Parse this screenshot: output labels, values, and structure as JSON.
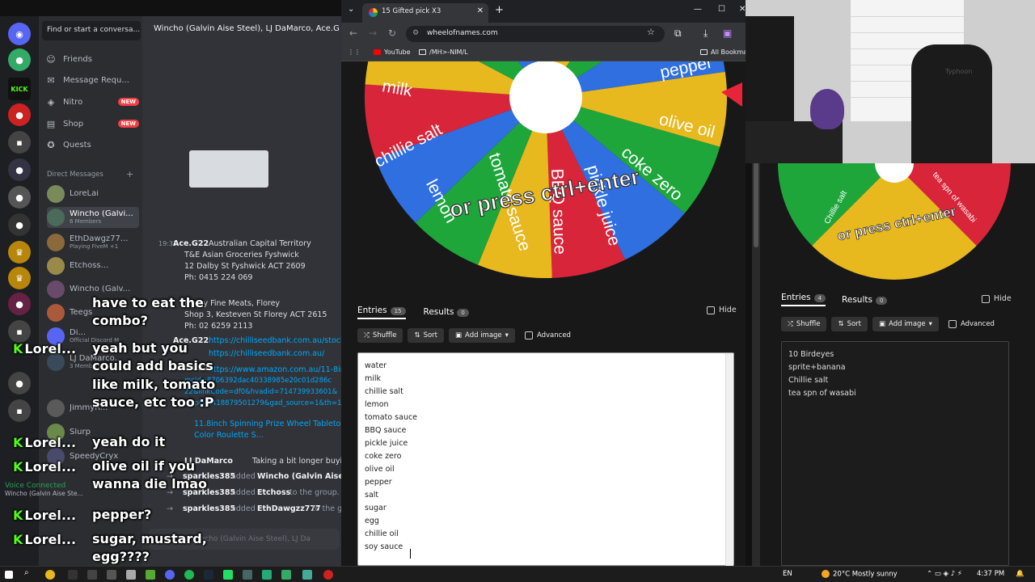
{
  "discord": {
    "search_placeholder": "Find or start a conversa...",
    "nav": [
      {
        "label": "Friends",
        "icon": "friends-icon"
      },
      {
        "label": "Message Requ...",
        "icon": "mail-icon"
      },
      {
        "label": "Nitro",
        "icon": "nitro-icon",
        "badge": "NEW"
      },
      {
        "label": "Shop",
        "icon": "shop-icon",
        "badge": "NEW"
      },
      {
        "label": "Quests",
        "icon": "quests-icon"
      }
    ],
    "dm_header": "Direct Messages",
    "dms": [
      {
        "name": "LoreLai",
        "sub": ""
      },
      {
        "name": "Wincho (Galvi...",
        "sub": "6 Members"
      },
      {
        "name": "EthDawgz77...",
        "sub": "Playing FiveM +1"
      },
      {
        "name": "Etchoss...",
        "sub": ""
      },
      {
        "name": "Wincho (Galv...",
        "sub": ""
      },
      {
        "name": "Teegs",
        "sub": ""
      },
      {
        "name": "Di...",
        "sub": "Official Discord M"
      },
      {
        "name": "LJ DaMarco...",
        "sub": "3 Members"
      },
      {
        "name": "JimmyR...",
        "sub": ""
      },
      {
        "name": "Slurp",
        "sub": ""
      },
      {
        "name": "SpeedyCryx",
        "sub": ""
      }
    ],
    "voice": {
      "title": "Voice Connected",
      "sub": "Wincho (Galvin Aise Ste..."
    },
    "chat_title": "Wincho (Galvin Aise Steel), LJ DaMarco, Ace.G",
    "chat": {
      "time1": "19:31",
      "author1": "Ace.G22",
      "line1": "Australian Capital Territory",
      "line2": "T&E Asian Groceries Fyshwick",
      "line3": "12 Dalby St Fyshwick ACT 2609",
      "line4": "Ph: 0415 224 069",
      "line5": "Florey Fine Meats, Florey",
      "line6": "Shop 3, Kesteven St Florey ACT 2615",
      "line7": "Ph: 02 6259 2113",
      "author2": "Ace.G22",
      "link1": "https://chilliseedbank.com.au/stock",
      "link2": "https://chilliseedbank.com.au/",
      "author3": "Ace.G22",
      "link3": "https://www.amazon.com.au/11-8inc",
      "link4": "mcid=8706392dac40338985e20c01d286c",
      "link5": "22&linkCode=df0&hvadid=714739933601&",
      "link6": "d=pla-2418879501279&gad_source=1&th=1",
      "link7": "11.8inch Spinning Prize Wheel Tabletop",
      "link8": "Color Roulette S...",
      "author4": "LJ DaMarco",
      "msg4": "Taking a bit longer buyin",
      "sys1_user": "sparkles385",
      "sys1_action": "added",
      "sys1_target": "Wincho (Galvin Aise St",
      "sys2_user": "sparkles385",
      "sys2_action": "added",
      "sys2_target": "Etchoss",
      "sys2_tail": "to the group.",
      "sys3_user": "sparkles385",
      "sys3_action": "added",
      "sys3_target": "EthDawgzz777",
      "sys3_tail": "to the gr",
      "input_placeholder": "Message Wincho (Galvin Aise Steel), LJ Da"
    }
  },
  "overlay_chat": [
    {
      "name": "",
      "msg": "have to eat the combo?"
    },
    {
      "name": "Lorel...",
      "msg": "yeah but you could add basics like milk, tomato sauce, etc too :P"
    },
    {
      "name": "Lorel...",
      "msg": "yeah do it"
    },
    {
      "name": "Lorel...",
      "msg": "olive oil if you wanna die lmao"
    },
    {
      "name": "Lorel...",
      "msg": "pepper?"
    },
    {
      "name": "Lorel...",
      "msg": "sugar, mustard, egg????"
    }
  ],
  "browser": {
    "tab_title": "15 Gifted pick X3",
    "url": "wheelofnames.com",
    "bookmarks": [
      "YouTube",
      "/MH>-NIM/L",
      "All Bookmar"
    ],
    "wheel_overlay_text": "or press ctrl+enter",
    "wheel_labels": [
      "milk",
      "pepper",
      "olive oil",
      "chillie salt",
      "lemon",
      "tomato sauce",
      "BBQ sauce",
      "pickle juice",
      "coke zero"
    ],
    "tabs": {
      "entries": "Entries",
      "entries_count": "15",
      "results": "Results",
      "results_count": "0"
    },
    "hide": "Hide",
    "buttons": {
      "shuffle": "Shuffle",
      "sort": "Sort",
      "add_image": "Add image",
      "advanced": "Advanced"
    },
    "entries": [
      "water",
      "milk",
      "chillie salt",
      "lemon",
      "tomato sauce",
      "BBQ sauce",
      "pickle juice",
      "coke zero",
      "olive oil",
      "pepper",
      "salt",
      "sugar",
      "egg",
      "chillie oil",
      "soy sauce"
    ]
  },
  "webcam": {
    "chair_text": "Typhoon"
  },
  "panel2": {
    "wheel_overlay_text": "or press ctrl+enter",
    "wheel_labels": [
      "Chillie salt",
      "tea spn of wasabi"
    ],
    "tabs": {
      "entries": "Entries",
      "entries_count": "4",
      "results": "Results",
      "results_count": "0"
    },
    "hide": "Hide",
    "buttons": {
      "shuffle": "Shuffle",
      "sort": "Sort",
      "add_image": "Add image",
      "advanced": "Advanced"
    },
    "entries": [
      "10 Birdeyes",
      "sprite+banana",
      "Chillie salt",
      "tea spn of wasabi"
    ]
  },
  "taskbar": {
    "lang": "EN",
    "weather": "20°C  Mostly sunny",
    "time": "4:37 PM"
  },
  "colors": {
    "wheel_yellow": "#e8b81f",
    "wheel_green": "#1ea63b",
    "wheel_blue": "#2f6fe0",
    "wheel_red": "#d9253a",
    "discord_bg": "#313338",
    "kick_green": "#53fc18"
  }
}
